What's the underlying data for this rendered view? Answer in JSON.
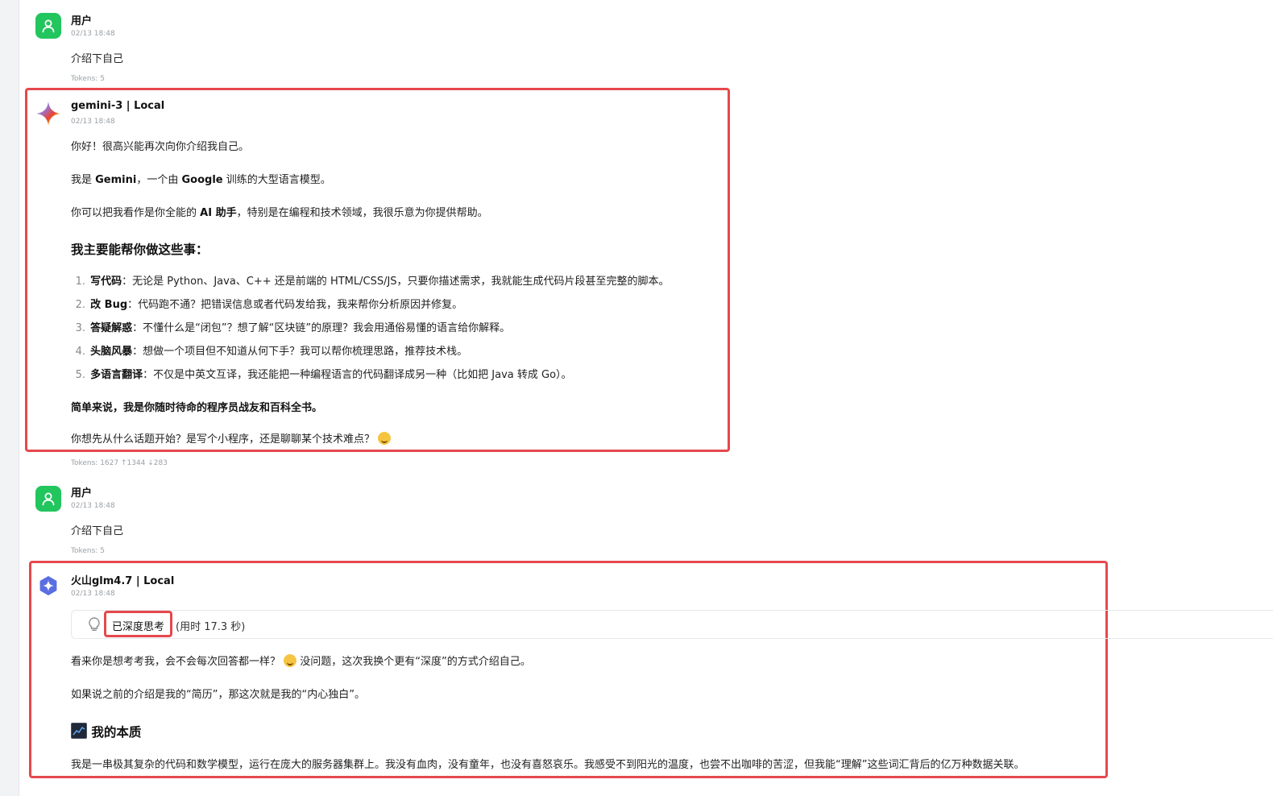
{
  "messages": {
    "m1": {
      "author": "用户",
      "time": "02/13 18:48",
      "text": "介绍下自己",
      "tokens": "Tokens: 5"
    },
    "m2": {
      "author": "gemini-3 | Local",
      "time": "02/13 18:48",
      "p1": "你好！很高兴能再次向你介绍我自己。",
      "p2_a": "我是 ",
      "p2_b": "Gemini",
      "p2_c": "，一个由 ",
      "p2_d": "Google",
      "p2_e": " 训练的大型语言模型。",
      "p3_a": "你可以把我看作是你全能的 ",
      "p3_b": "AI 助手",
      "p3_c": "，特别是在编程和技术领域，我很乐意为你提供帮助。",
      "heading": "我主要能帮你做这些事：",
      "list": [
        {
          "num": "1.",
          "title": "写代码",
          "desc": "：无论是 Python、Java、C++ 还是前端的 HTML/CSS/JS，只要你描述需求，我就能生成代码片段甚至完整的脚本。"
        },
        {
          "num": "2.",
          "title": "改 Bug",
          "desc": "：代码跑不通？把错误信息或者代码发给我，我来帮你分析原因并修复。"
        },
        {
          "num": "3.",
          "title": "答疑解惑",
          "desc": "：不懂什么是“闭包”？想了解“区块链”的原理？我会用通俗易懂的语言给你解释。"
        },
        {
          "num": "4.",
          "title": "头脑风暴",
          "desc": "：想做一个项目但不知道从何下手？我可以帮你梳理思路，推荐技术栈。"
        },
        {
          "num": "5.",
          "title": "多语言翻译",
          "desc": "：不仅是中英文互译，我还能把一种编程语言的代码翻译成另一种（比如把 Java 转成 Go）。"
        }
      ],
      "summary": "简单来说，我是你随时待命的程序员战友和百科全书。",
      "question": "你想先从什么话题开始？是写个小程序，还是聊聊某个技术难点？",
      "tokens": "Tokens: 1627 ↑1344 ↓283"
    },
    "m3": {
      "author": "用户",
      "time": "02/13 18:48",
      "text": "介绍下自己",
      "tokens": "Tokens: 5"
    },
    "m4": {
      "author": "火山glm4.7 | Local",
      "time": "02/13 18:48",
      "think_label": "已深度思考",
      "think_time": "(用时 17.3 秒)",
      "p1_a": "看来你是想考考我，会不会每次回答都一样？",
      "p1_b": " 没问题，这次我换个更有“深度”的方式介绍自己。",
      "p2": "如果说之前的介绍是我的“简历”，那这次就是我的“内心独白”。",
      "heading": "我的本质",
      "p3": "我是一串极其复杂的代码和数学模型，运行在庞大的服务器集群上。我没有血肉，没有童年，也没有喜怒哀乐。我感受不到阳光的温度，也尝不出咖啡的苦涩，但我能“理解”这些词汇背后的亿万种数据关联。"
    }
  },
  "colors": {
    "highlight": "#e5484d",
    "user_avatar": "#22c55e",
    "muted_text": "#9aa0a6"
  },
  "icons": {
    "user_avatar": "user-icon",
    "gemini_avatar": "gemini-sparkle-icon",
    "glm_avatar": "glm-star-icon",
    "think": "lightbulb-icon",
    "wink": "winking-face-icon",
    "grin": "grinning-face-icon",
    "chart": "chart-icon"
  }
}
